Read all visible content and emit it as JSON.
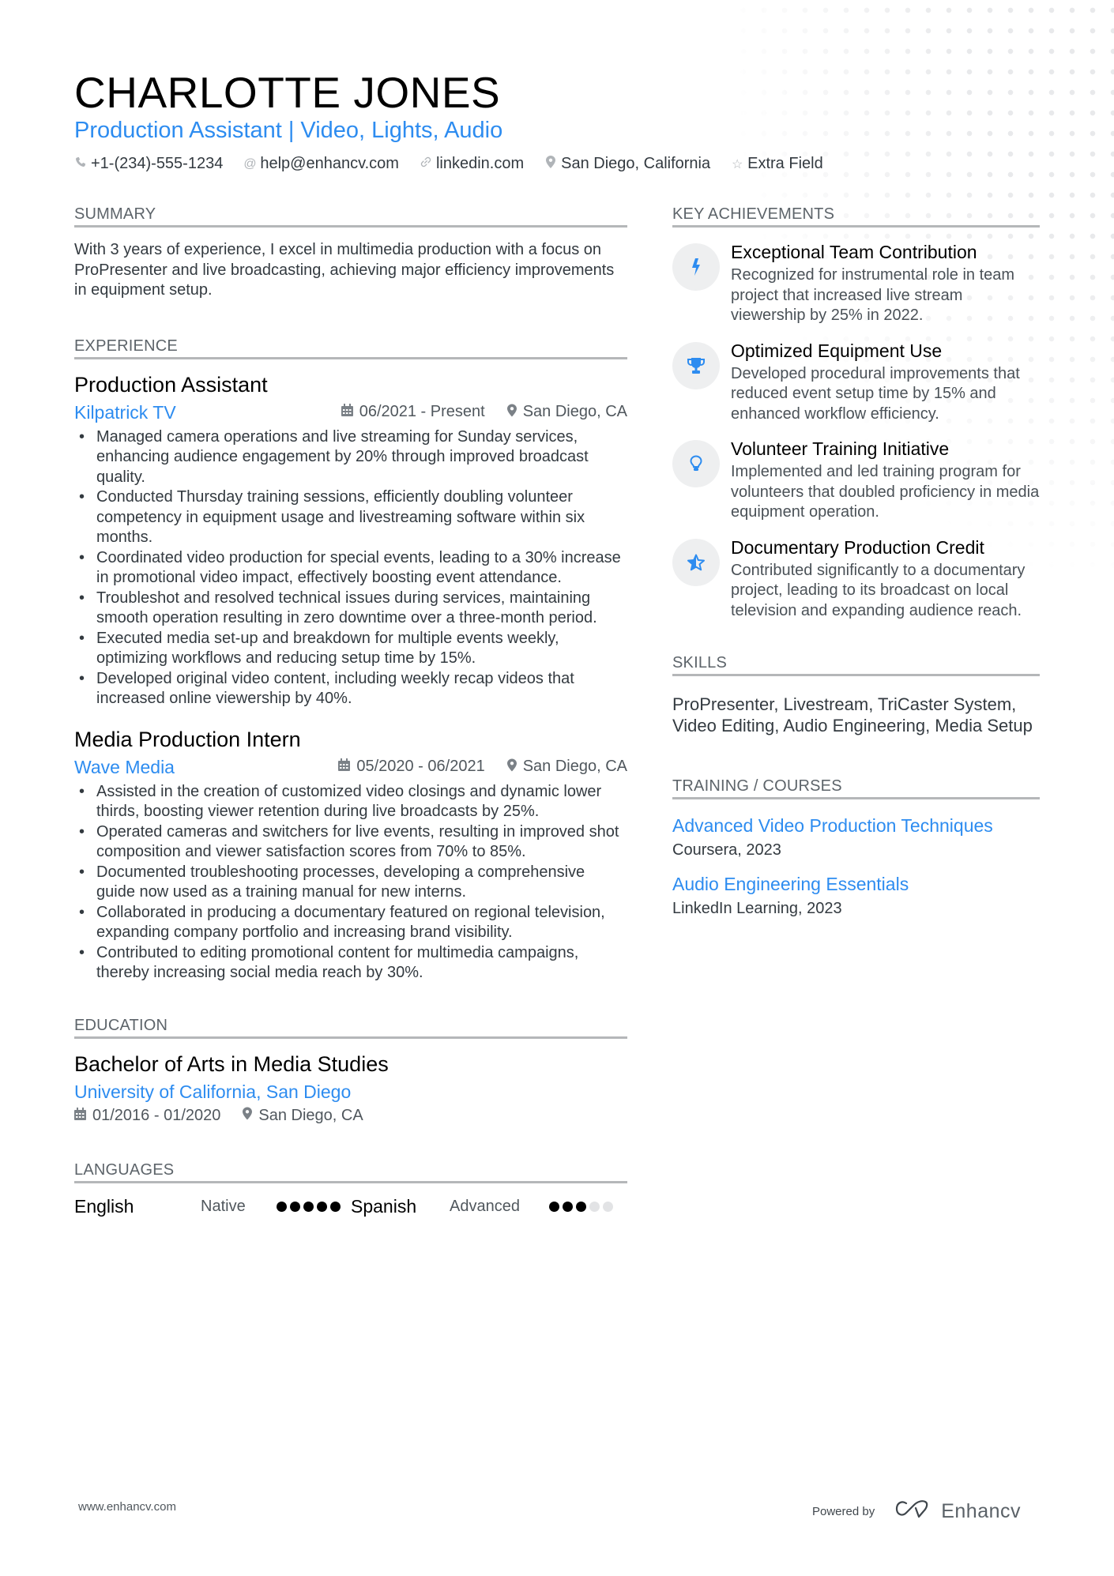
{
  "header": {
    "name": "CHARLOTTE JONES",
    "title": "Production Assistant | Video, Lights, Audio",
    "contacts": [
      {
        "icon": "phone-icon",
        "text": "+1-(234)-555-1234"
      },
      {
        "icon": "at-icon",
        "text": "help@enhancv.com"
      },
      {
        "icon": "link-icon",
        "text": "linkedin.com"
      },
      {
        "icon": "location-icon",
        "text": "San Diego, California"
      },
      {
        "icon": "star-icon",
        "text": "Extra Field"
      }
    ]
  },
  "summary": {
    "heading": "SUMMARY",
    "text": "With 3 years of experience, I excel in multimedia production with a focus on ProPresenter and live broadcasting, achieving major efficiency improvements in equipment setup."
  },
  "experience": {
    "heading": "EXPERIENCE",
    "jobs": [
      {
        "title": "Production Assistant",
        "company": "Kilpatrick TV",
        "dates": "06/2021 - Present",
        "location": "San Diego, CA",
        "bullets": [
          "Managed camera operations and live streaming for Sunday services, enhancing audience engagement by 20% through improved broadcast quality.",
          "Conducted Thursday training sessions, efficiently doubling volunteer competency in equipment usage and livestreaming software within six months.",
          "Coordinated video production for special events, leading to a 30% increase in promotional video impact, effectively boosting event attendance.",
          "Troubleshot and resolved technical issues during services, maintaining smooth operation resulting in zero downtime over a three-month period.",
          "Executed media set-up and breakdown for multiple events weekly, optimizing workflows and reducing setup time by 15%.",
          "Developed original video content, including weekly recap videos that increased online viewership by 40%."
        ]
      },
      {
        "title": "Media Production Intern",
        "company": "Wave Media",
        "dates": "05/2020 - 06/2021",
        "location": "San Diego, CA",
        "bullets": [
          "Assisted in the creation of customized video closings and dynamic lower thirds, boosting viewer retention during live broadcasts by 25%.",
          "Operated cameras and switchers for live events, resulting in improved shot composition and viewer satisfaction scores from 70% to 85%.",
          "Documented troubleshooting processes, developing a comprehensive guide now used as a training manual for new interns.",
          "Collaborated in producing a documentary featured on regional television, expanding company portfolio and increasing brand visibility.",
          "Contributed to editing promotional content for multimedia campaigns, thereby increasing social media reach by 30%."
        ]
      }
    ]
  },
  "education": {
    "heading": "EDUCATION",
    "degree": "Bachelor of Arts in Media Studies",
    "school": "University of California, San Diego",
    "dates": "01/2016 - 01/2020",
    "location": "San Diego, CA"
  },
  "languages": {
    "heading": "LANGUAGES",
    "items": [
      {
        "name": "English",
        "level": "Native",
        "rating": 5,
        "max": 5
      },
      {
        "name": "Spanish",
        "level": "Advanced",
        "rating": 3,
        "max": 5
      }
    ]
  },
  "achievements": {
    "heading": "KEY ACHIEVEMENTS",
    "items": [
      {
        "icon": "bolt-icon",
        "title": "Exceptional Team Contribution",
        "desc": "Recognized for instrumental role in team project that increased live stream viewership by 25% in 2022."
      },
      {
        "icon": "trophy-icon",
        "title": "Optimized Equipment Use",
        "desc": "Developed procedural improvements that reduced event setup time by 15% and enhanced workflow efficiency."
      },
      {
        "icon": "lightbulb-icon",
        "title": "Volunteer Training Initiative",
        "desc": "Implemented and led training program for volunteers that doubled proficiency in media equipment operation."
      },
      {
        "icon": "star-half-icon",
        "title": "Documentary Production Credit",
        "desc": "Contributed significantly to a documentary project, leading to its broadcast on local television and expanding audience reach."
      }
    ]
  },
  "skills": {
    "heading": "SKILLS",
    "text": "ProPresenter, Livestream, TriCaster System, Video Editing, Audio Engineering, Media Setup"
  },
  "training": {
    "heading": "TRAINING / COURSES",
    "items": [
      {
        "title": "Advanced Video Production Techniques",
        "provider": "Coursera, 2023"
      },
      {
        "title": "Audio Engineering Essentials",
        "provider": "LinkedIn Learning, 2023"
      }
    ]
  },
  "footer": {
    "website": "www.enhancv.com",
    "powered_by": "Powered by",
    "brand": "Enhancv"
  },
  "colors": {
    "accent": "#2d8cf0",
    "text": "#333a40",
    "rule": "#b5b7b9"
  }
}
